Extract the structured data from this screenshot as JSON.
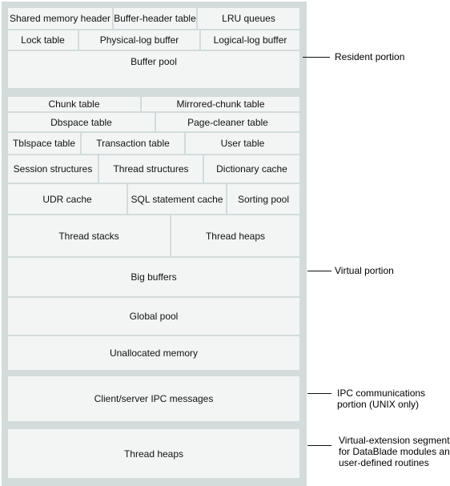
{
  "segments": {
    "resident": {
      "label": "Resident portion",
      "rows": [
        [
          "Shared memory header",
          "Buffer-header table",
          "LRU queues"
        ],
        [
          "Lock table",
          "Physical-log buffer",
          "Logical-log buffer"
        ],
        [
          "Buffer pool"
        ]
      ]
    },
    "virtual": {
      "label": "Virtual portion",
      "rows": [
        [
          "Chunk table",
          "Mirrored-chunk table"
        ],
        [
          "Dbspace table",
          "Page-cleaner table"
        ],
        [
          "Tblspace table",
          "Transaction table",
          "User table"
        ],
        [
          "Session structures",
          "Thread structures",
          "Dictionary cache"
        ],
        [
          "UDR cache",
          "SQL statement cache",
          "Sorting pool"
        ],
        [
          "Thread stacks",
          "Thread heaps"
        ],
        [
          "Big buffers"
        ],
        [
          "Global pool"
        ],
        [
          "Unallocated memory"
        ]
      ]
    },
    "ipc": {
      "label_lines": [
        "IPC communications",
        "portion (UNIX only)"
      ],
      "rows": [
        [
          "Client/server IPC messages"
        ]
      ]
    },
    "extension": {
      "label_lines": [
        "Virtual-extension segments",
        "for DataBlade modules and",
        "user-defined routines"
      ],
      "rows": [
        [
          "Thread heaps"
        ]
      ]
    }
  },
  "colors": {
    "frame": "#d3dbdb",
    "box": "#f3f5f5",
    "line": "#111111"
  }
}
